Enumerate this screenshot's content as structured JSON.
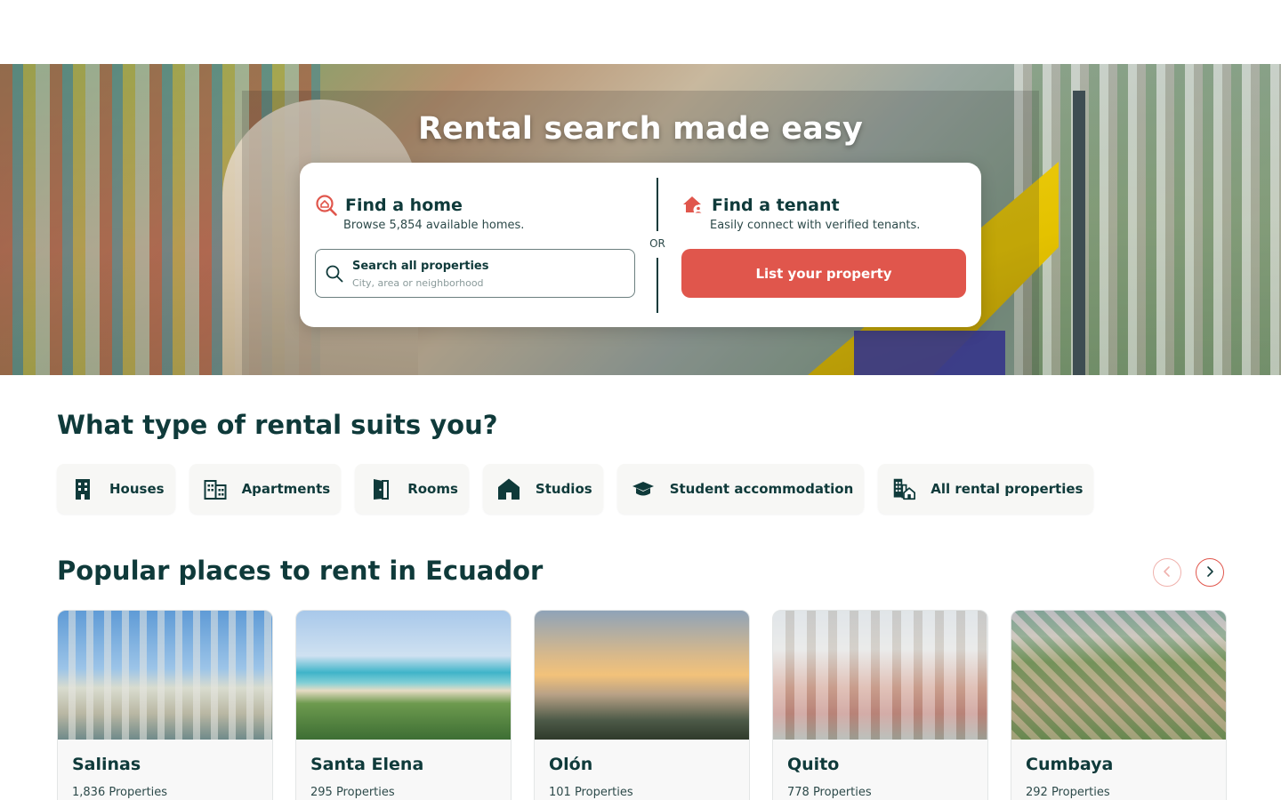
{
  "hero": {
    "title": "Rental search made easy"
  },
  "find_home": {
    "title": "Find a home",
    "subtitle": "Browse 5,854 available homes.",
    "icon": "home-search-icon"
  },
  "search": {
    "title": "Search all properties",
    "placeholder": "City, area or neighborhood",
    "icon": "search-icon"
  },
  "separator": "OR",
  "find_tenant": {
    "title": "Find a tenant",
    "subtitle": "Easily connect with verified tenants.",
    "button_label": "List your property",
    "icon": "home-user-icon"
  },
  "rental_types": {
    "title": "What type of rental suits you?",
    "items": [
      {
        "label": "Houses",
        "icon": "building-icon"
      },
      {
        "label": "Apartments",
        "icon": "apartment-icon"
      },
      {
        "label": "Rooms",
        "icon": "door-icon"
      },
      {
        "label": "Studios",
        "icon": "house-icon"
      },
      {
        "label": "Student accommodation",
        "icon": "graduation-cap-icon"
      },
      {
        "label": "All rental properties",
        "icon": "buildings-home-icon"
      }
    ]
  },
  "popular": {
    "title": "Popular places to rent in Ecuador",
    "cities": [
      {
        "name": "Salinas",
        "count": "1,836 Properties"
      },
      {
        "name": "Santa Elena",
        "count": "295 Properties"
      },
      {
        "name": "Olón",
        "count": "101 Properties"
      },
      {
        "name": "Quito",
        "count": "778 Properties"
      },
      {
        "name": "Cumbaya",
        "count": "292 Properties"
      }
    ]
  },
  "colors": {
    "accent": "#e0564c",
    "text_primary": "#0f3a3a",
    "chip_bg": "#f7f7f5"
  }
}
